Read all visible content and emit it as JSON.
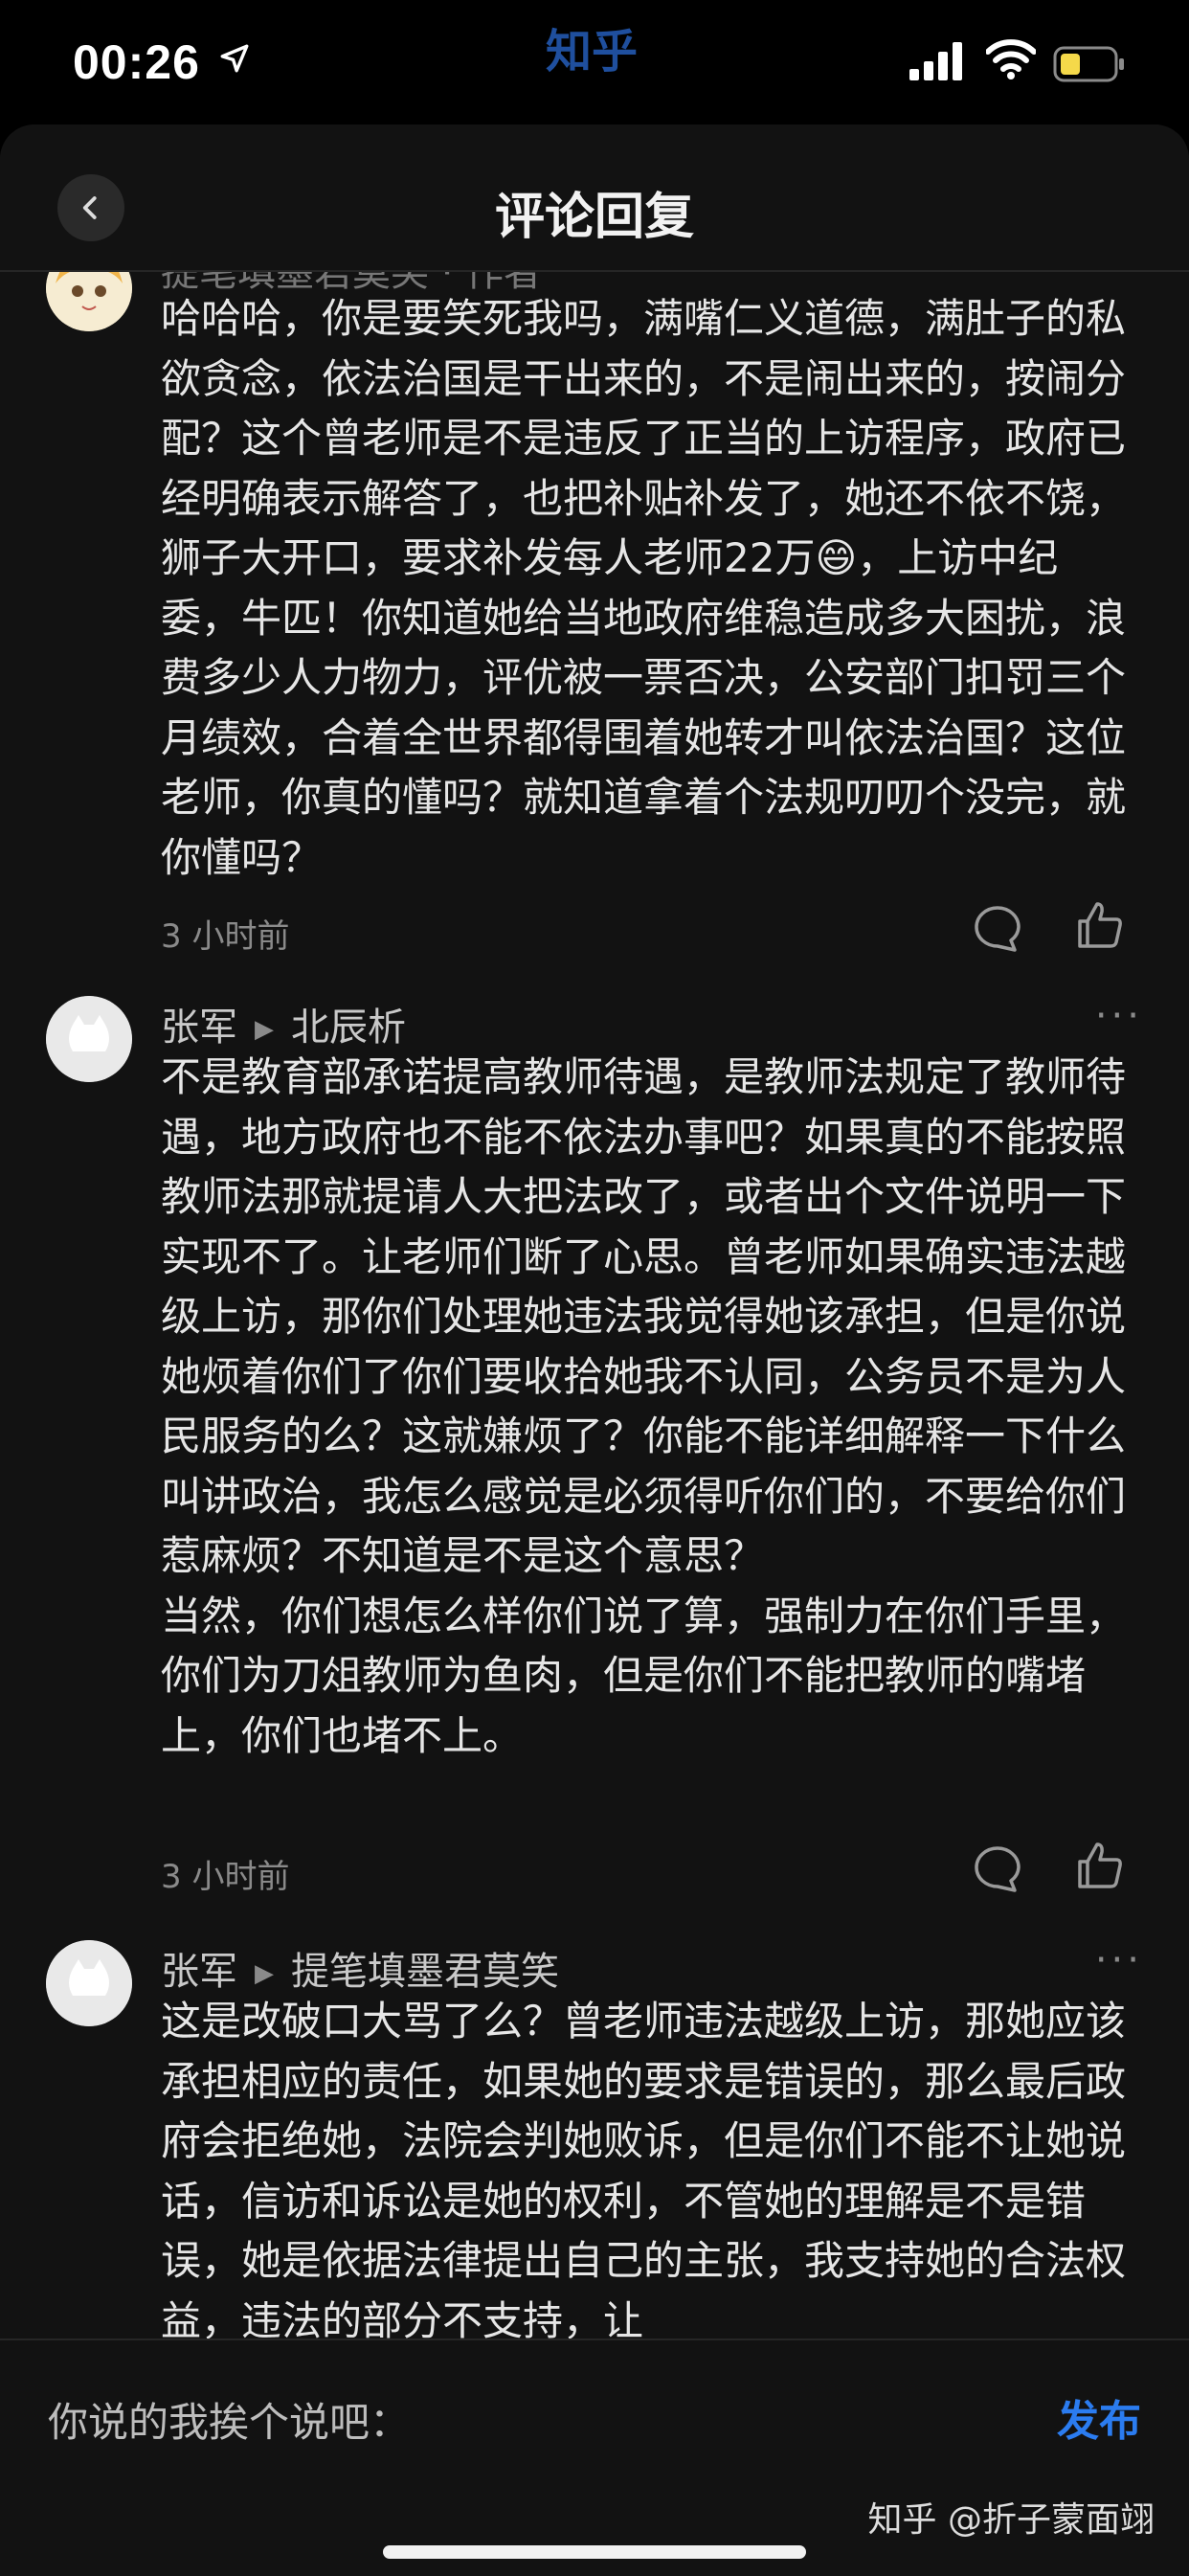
{
  "status_bar": {
    "time": "00:26",
    "watermark": "知乎"
  },
  "header": {
    "title": "评论回复"
  },
  "comments": [
    {
      "username_partial": "提笔填墨君莫笑 · 作者",
      "text": "哈哈哈，你是要笑死我吗，满嘴仁义道德，满肚子的私欲贪念，依法治国是干出来的，不是闹出来的，按闹分配？这个曾老师是不是违反了正当的上访程序，政府已经明确表示解答了，也把补贴补发了，她还不依不饶，狮子大开口，要求补发每人老师22万😄，上访中纪委，牛匹！你知道她给当地政府维稳造成多大困扰，浪费多少人力物力，评优被一票否决，公安部门扣罚三个月绩效，合着全世界都得围着她转才叫依法治国？这位老师，你真的懂吗？就知道拿着个法规叨叨个没完，就你懂吗？",
      "time": "3 小时前"
    },
    {
      "username": "张军",
      "reply_to": "北辰析",
      "text": "不是教育部承诺提高教师待遇，是教师法规定了教师待遇，地方政府也不能不依法办事吧？如果真的不能按照教师法那就提请人大把法改了，或者出个文件说明一下实现不了。让老师们断了心思。曾老师如果确实违法越级上访，那你们处理她违法我觉得她该承担，但是你说她烦着你们了你们要收拾她我不认同，公务员不是为人民服务的么？这就嫌烦了？你能不能详细解释一下什么叫讲政治，我怎么感觉是必须得听你们的，不要给你们惹麻烦？不知道是不是这个意思？\n当然，你们想怎么样你们说了算，强制力在你们手里，你们为刀俎教师为鱼肉，但是你们不能把教师的嘴堵上，你们也堵不上。",
      "time": "3 小时前"
    },
    {
      "username": "张军",
      "reply_to": "提笔填墨君莫笑",
      "text": "这是改破口大骂了么？曾老师违法越级上访，那她应该承担相应的责任，如果她的要求是错误的，那么最后政府会拒绝她，法院会判她败诉，但是你们不能不让她说话，信访和诉讼是她的权利，不管她的理解是不是错误，她是依据法律提出自己的主张，我支持她的合法权益，违法的部分不支持，让"
    }
  ],
  "more_label": "···",
  "compose": {
    "placeholder": "你说的我挨个说吧：",
    "publish_label": "发布",
    "credit": "知乎 @折子蒙面翊"
  },
  "colors": {
    "accent": "#2b7cf0",
    "background": "#121212"
  },
  "icons": [
    "location-arrow-icon",
    "signal-icon",
    "wifi-icon",
    "battery-icon",
    "back-chevron-icon",
    "comment-bubble-icon",
    "thumbs-up-icon",
    "more-dots-icon"
  ]
}
